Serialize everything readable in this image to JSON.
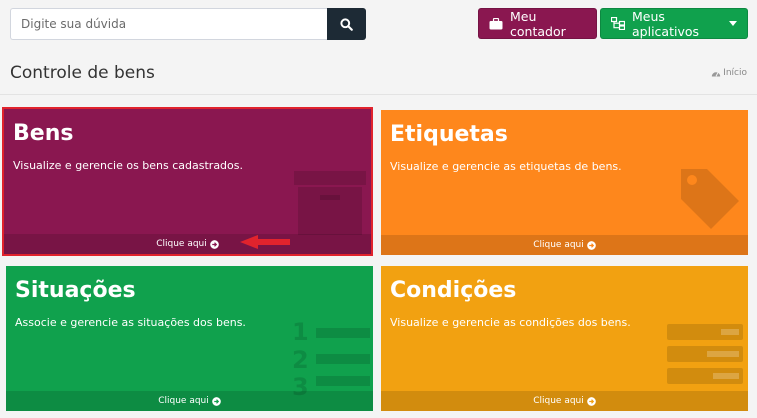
{
  "search": {
    "placeholder": "Digite sua dúvida"
  },
  "header": {
    "meu_contador_label": "Meu contador",
    "meus_aplicativos_label": "Meus aplicativos"
  },
  "page": {
    "title": "Controle de bens",
    "breadcrumb": "Início"
  },
  "tiles": [
    {
      "title": "Bens",
      "description": "Visualize e gerencie os bens cadastrados.",
      "link": "Clique aqui",
      "color": "#8a1750"
    },
    {
      "title": "Etiquetas",
      "description": "Visualize e gerencie as etiquetas de bens.",
      "link": "Clique aqui",
      "color": "#fe871c"
    },
    {
      "title": "Situações",
      "description": "Associe e gerencie as situações dos bens.",
      "link": "Clique aqui",
      "color": "#10a14d"
    },
    {
      "title": "Condições",
      "description": "Visualize e gerencie as condições dos bens.",
      "link": "Clique aqui",
      "color": "#f2a111"
    }
  ],
  "colors": {
    "dark": "#1d2a35",
    "highlight": "#e1232d"
  },
  "icons": {
    "search": "search-icon",
    "briefcase": "briefcase-icon",
    "apps": "sitemap-icon",
    "dashboard": "dashboard-icon",
    "arrow_circle": "arrow-circle-right-icon",
    "archive": "archive-icon",
    "tag": "tag-icon",
    "list_ol": "list-ol-icon",
    "tasks": "tasks-icon"
  }
}
